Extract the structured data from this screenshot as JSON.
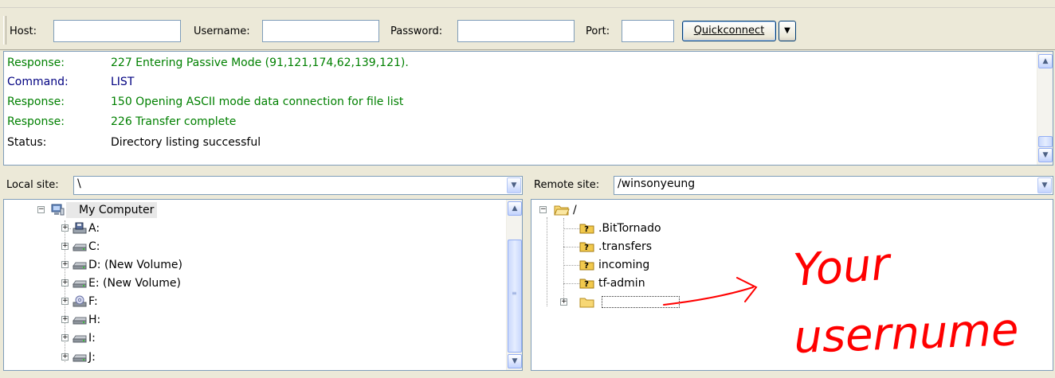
{
  "quickconnect": {
    "host_label": "Host:",
    "host_value": "",
    "username_label": "Username:",
    "username_value": "",
    "password_label": "Password:",
    "password_value": "",
    "port_label": "Port:",
    "port_value": "",
    "button_label": "Quickconnect",
    "dropdown_icon": "chevron-down-icon"
  },
  "log": [
    {
      "label": "Response:",
      "message": "227 Entering Passive Mode (91,121,174,62,139,121).",
      "type": "response"
    },
    {
      "label": "Command:",
      "message": "LIST",
      "type": "command"
    },
    {
      "label": "Response:",
      "message": "150 Opening ASCII mode data connection for file list",
      "type": "response"
    },
    {
      "label": "Response:",
      "message": "226 Transfer complete",
      "type": "response"
    },
    {
      "label": "Status:",
      "message": "Directory listing successful",
      "type": "status"
    }
  ],
  "local": {
    "label": "Local site:",
    "path": "\\",
    "tree": [
      {
        "label": "My Computer",
        "icon": "computer-icon",
        "level": 0,
        "expanded": true,
        "selected": true
      },
      {
        "label": "A:",
        "icon": "floppy-drive-icon",
        "level": 1
      },
      {
        "label": "C:",
        "icon": "hard-drive-icon",
        "level": 1
      },
      {
        "label": "D: (New Volume)",
        "icon": "hard-drive-icon",
        "level": 1
      },
      {
        "label": "E: (New Volume)",
        "icon": "hard-drive-icon",
        "level": 1
      },
      {
        "label": "F:",
        "icon": "cd-drive-icon",
        "level": 1
      },
      {
        "label": "H:",
        "icon": "hard-drive-icon",
        "level": 1
      },
      {
        "label": "I:",
        "icon": "hard-drive-icon",
        "level": 1
      },
      {
        "label": "J:",
        "icon": "hard-drive-icon",
        "level": 1
      }
    ]
  },
  "remote": {
    "label": "Remote site:",
    "path": "/winsonyeung",
    "tree": [
      {
        "label": "/",
        "icon": "folder-open-icon",
        "level": 0,
        "expanded": true
      },
      {
        "label": ".BitTornado",
        "icon": "unknown-folder-icon",
        "level": 1
      },
      {
        "label": ".transfers",
        "icon": "unknown-folder-icon",
        "level": 1
      },
      {
        "label": "incoming",
        "icon": "unknown-folder-icon",
        "level": 1
      },
      {
        "label": "tf-admin",
        "icon": "unknown-folder-icon",
        "level": 1
      },
      {
        "label": "",
        "icon": "folder-icon",
        "level": 1,
        "collapsed": true
      }
    ]
  },
  "annotation": {
    "line1": "Your",
    "line2": "usernume",
    "color": "#ff0000"
  },
  "colors": {
    "response": "#008000",
    "command": "#000080",
    "status": "#000000",
    "window_bg": "#ece9d8"
  }
}
